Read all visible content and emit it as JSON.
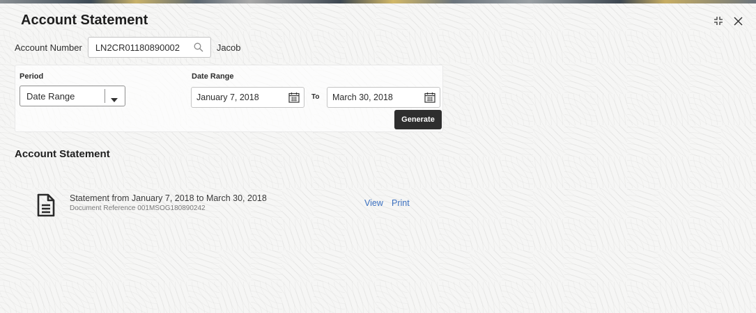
{
  "header": {
    "title": "Account Statement"
  },
  "window_controls": {
    "minimize_icon": "minimize-corners-icon",
    "close_icon": "close-icon"
  },
  "account": {
    "label": "Account Number",
    "value": "LN2CR01180890002",
    "name": "Jacob"
  },
  "filters": {
    "period_label": "Period",
    "period_value": "Date Range",
    "date_range_label": "Date Range",
    "from_date": "January 7, 2018",
    "to_label": "To",
    "to_date": "March 30, 2018",
    "generate_label": "Generate"
  },
  "statement_section": {
    "title": "Account Statement",
    "items": [
      {
        "description": "Statement from January 7, 2018 to March 30, 2018",
        "reference": "Document Reference 001MSOG180890242",
        "view_label": "View",
        "print_label": "Print"
      }
    ]
  },
  "colors": {
    "link": "#3a6fbf",
    "button": "#2e2e2e"
  }
}
